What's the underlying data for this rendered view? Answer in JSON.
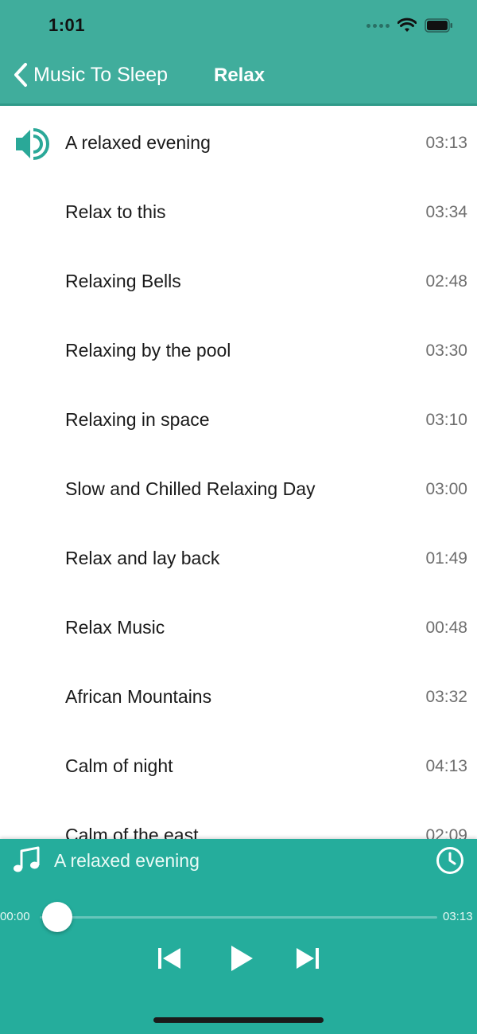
{
  "status_bar": {
    "time": "1:01"
  },
  "nav": {
    "back_label": "Music To Sleep",
    "title": "Relax"
  },
  "tracks": [
    {
      "title": "A relaxed evening",
      "duration": "03:13",
      "playing": true
    },
    {
      "title": "Relax to this",
      "duration": "03:34"
    },
    {
      "title": "Relaxing Bells",
      "duration": "02:48"
    },
    {
      "title": "Relaxing by the pool",
      "duration": "03:30"
    },
    {
      "title": "Relaxing in space",
      "duration": "03:10"
    },
    {
      "title": "Slow and Chilled Relaxing Day",
      "duration": "03:00"
    },
    {
      "title": "Relax and lay back",
      "duration": "01:49"
    },
    {
      "title": "Relax Music",
      "duration": "00:48"
    },
    {
      "title": "African Mountains",
      "duration": "03:32"
    },
    {
      "title": "Calm of night",
      "duration": "04:13"
    },
    {
      "title": "Calm of the east",
      "duration": "02:09"
    }
  ],
  "player": {
    "now_playing": "A relaxed evening",
    "elapsed": "00:00",
    "total": "03:13",
    "progress": 0
  },
  "colors": {
    "accent": "#25ad9c",
    "header": "#40ad9c"
  },
  "icons": {
    "now_playing_row": "speaker-icon",
    "player_note": "music-note-icon",
    "timer": "clock-icon",
    "prev": "skip-previous-icon",
    "play": "play-icon",
    "next": "skip-next-icon"
  }
}
